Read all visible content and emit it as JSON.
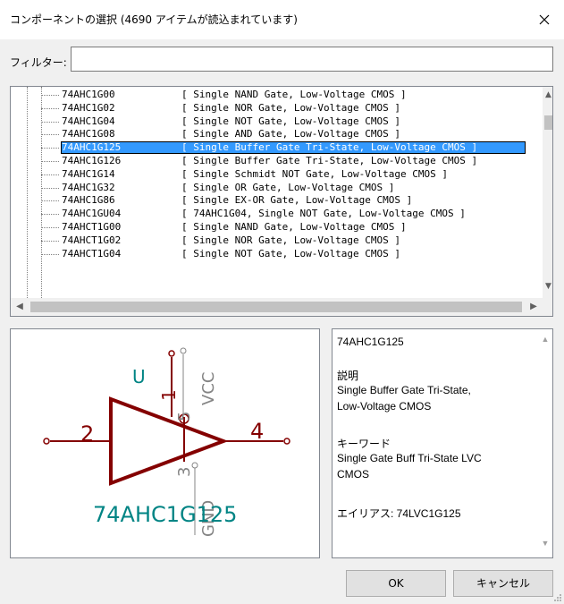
{
  "window": {
    "title": "コンポーネントの選択 (4690 アイテムが読込まれています)"
  },
  "filter": {
    "label": "フィルター:",
    "value": "",
    "placeholder": ""
  },
  "tree": {
    "rows": [
      {
        "name": "74AHC1G00",
        "desc": "[ Single NAND Gate, Low-Voltage CMOS ]",
        "selected": false
      },
      {
        "name": "74AHC1G02",
        "desc": "[ Single NOR Gate, Low-Voltage CMOS ]",
        "selected": false
      },
      {
        "name": "74AHC1G04",
        "desc": "[ Single NOT Gate, Low-Voltage CMOS ]",
        "selected": false
      },
      {
        "name": "74AHC1G08",
        "desc": "[ Single AND Gate, Low-Voltage CMOS ]",
        "selected": false
      },
      {
        "name": "74AHC1G125",
        "desc": "[ Single Buffer Gate Tri-State, Low-Voltage CMOS ]",
        "selected": true
      },
      {
        "name": "74AHC1G126",
        "desc": "[ Single Buffer Gate Tri-State, Low-Voltage CMOS ]",
        "selected": false
      },
      {
        "name": "74AHC1G14",
        "desc": "[ Single Schmidt NOT Gate, Low-Voltage CMOS ]",
        "selected": false
      },
      {
        "name": "74AHC1G32",
        "desc": "[ Single OR Gate, Low-Voltage CMOS ]",
        "selected": false
      },
      {
        "name": "74AHC1G86",
        "desc": "[ Single EX-OR Gate, Low-Voltage CMOS ]",
        "selected": false
      },
      {
        "name": "74AHC1GU04",
        "desc": "[ 74AHC1G04, Single NOT Gate, Low-Voltage CMOS ]",
        "selected": false
      },
      {
        "name": "74AHCT1G00",
        "desc": "[ Single NAND Gate, Low-Voltage CMOS ]",
        "selected": false
      },
      {
        "name": "74AHCT1G02",
        "desc": "[ Single NOR Gate, Low-Voltage CMOS ]",
        "selected": false
      },
      {
        "name": "74AHCT1G04",
        "desc": "[ Single NOT Gate, Low-Voltage CMOS ]",
        "selected": false
      }
    ]
  },
  "preview": {
    "ref": "U",
    "value": "74AHC1G125",
    "vcc": "VCC",
    "gnd": "GND",
    "pin_1": "1",
    "pin_2": "2",
    "pin_3": "3",
    "pin_4": "4",
    "pin_5": "5",
    "colors": {
      "symbol": "#840000",
      "text": "#008484",
      "pin_text": "#848484"
    }
  },
  "info": {
    "name": "74AHC1G125",
    "desc_heading": "説明",
    "desc_line1": "Single Buffer Gate Tri-State,",
    "desc_line2": "Low-Voltage CMOS",
    "kw_heading": "キーワード",
    "kw_line1": "Single Gate Buff Tri-State LVC",
    "kw_line2": "CMOS",
    "alias": "エイリアス: 74LVC1G125"
  },
  "buttons": {
    "ok": "OK",
    "cancel": "キャンセル"
  }
}
